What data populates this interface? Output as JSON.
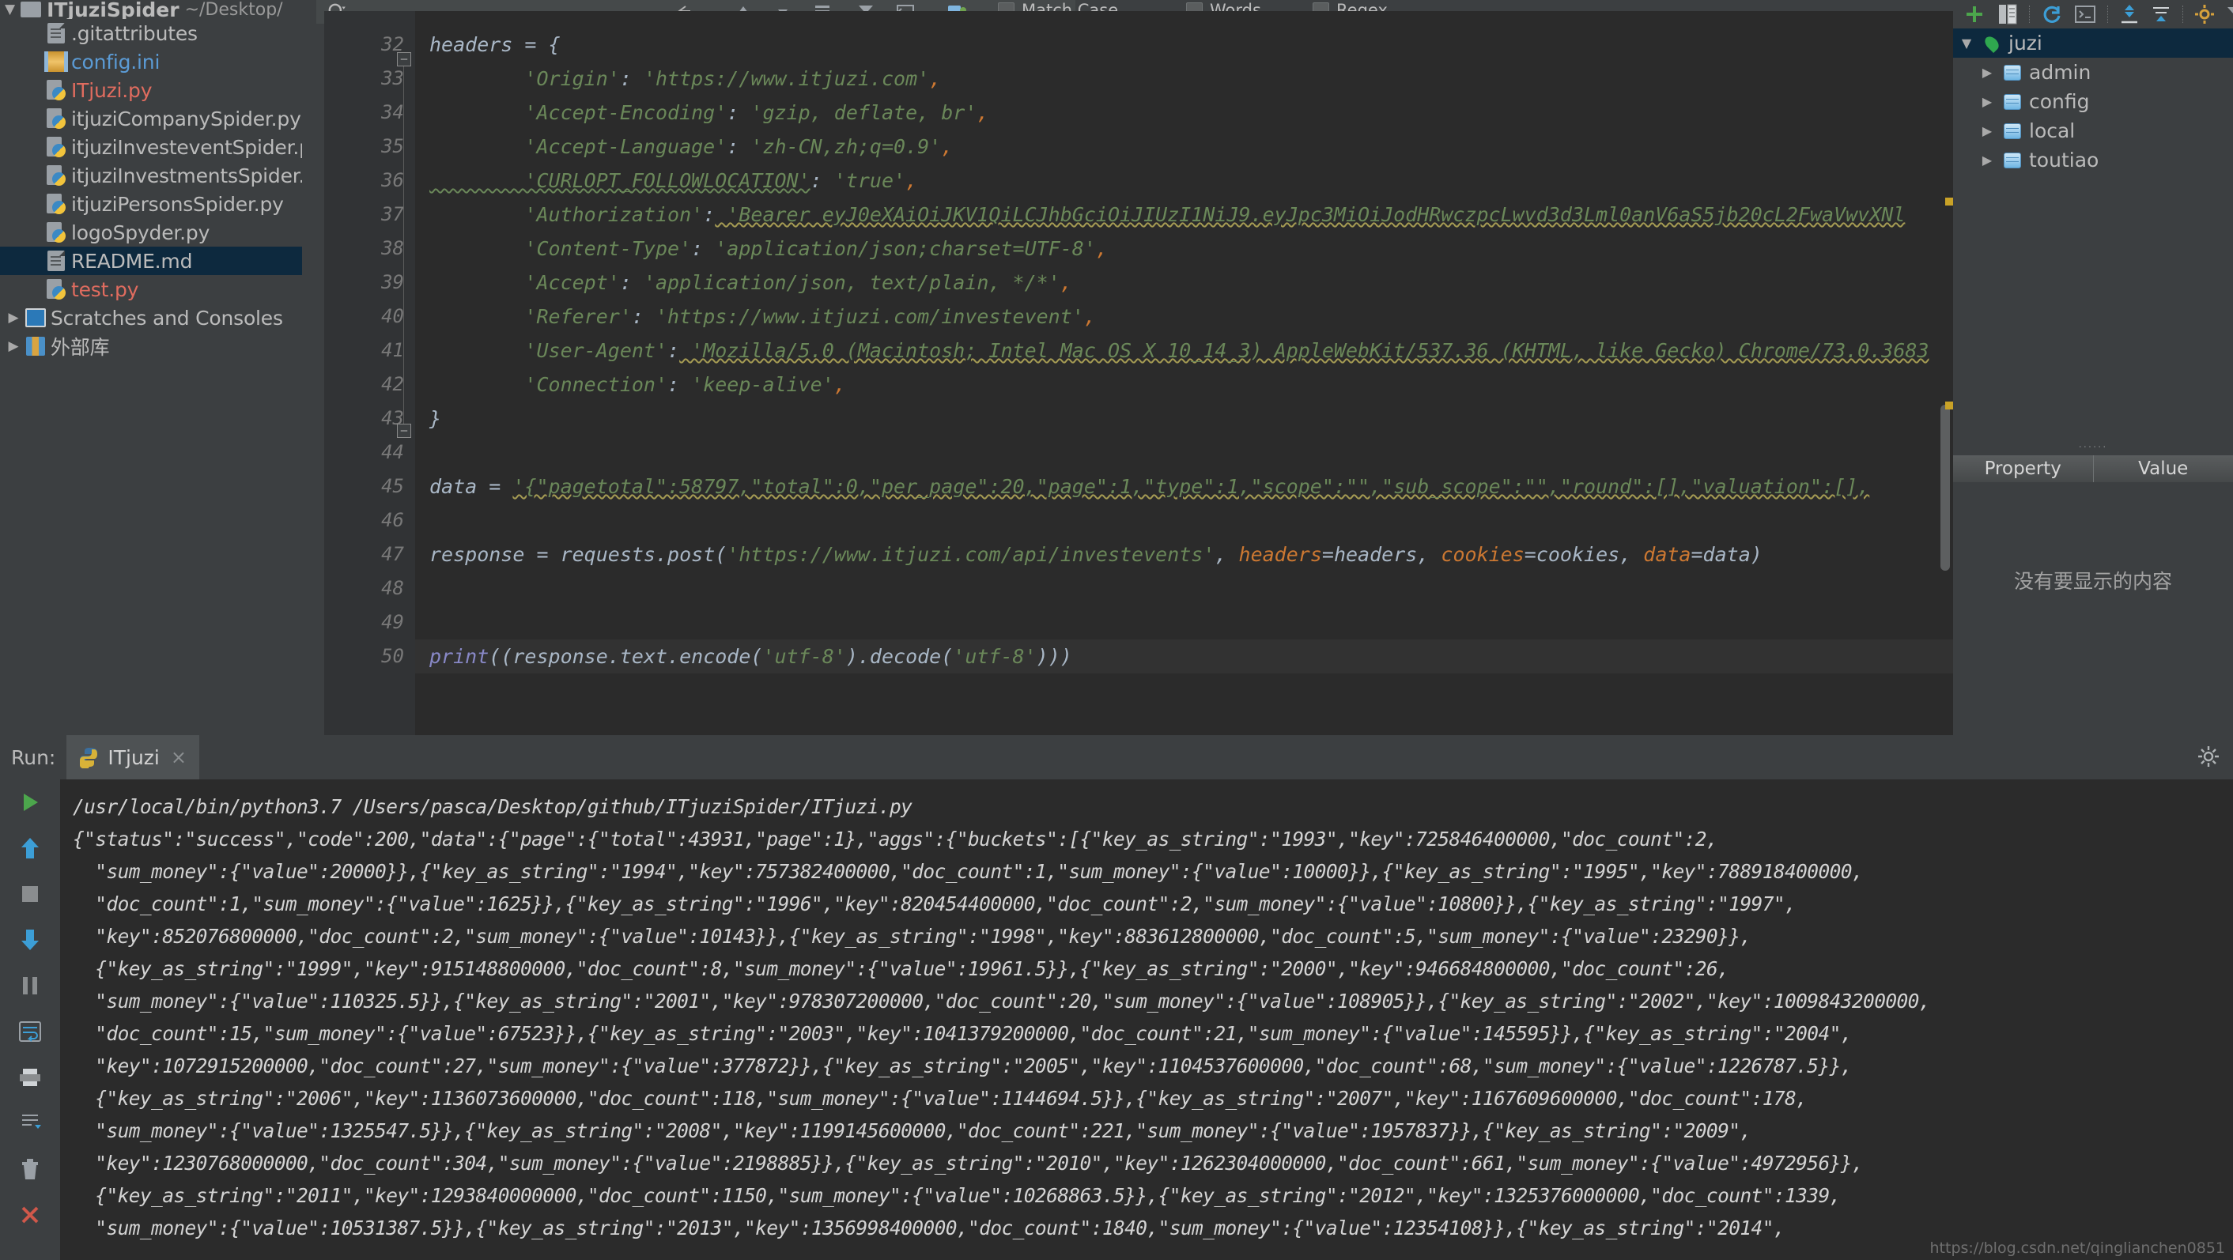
{
  "project": {
    "name": "ITjuziSpider",
    "path": "~/Desktop/",
    "tree": [
      {
        "label": ".gitattributes",
        "icon": "doc-icon",
        "color": "default",
        "indent": 1,
        "arrow": "",
        "selected": false
      },
      {
        "label": "config.ini",
        "icon": "ini-icon",
        "color": "blue",
        "indent": 1,
        "arrow": "",
        "selected": false
      },
      {
        "label": "ITjuzi.py",
        "icon": "python-file-icon",
        "color": "red",
        "indent": 1,
        "arrow": "",
        "selected": false
      },
      {
        "label": "itjuziCompanySpider.py",
        "icon": "python-file-icon",
        "color": "default",
        "indent": 1,
        "arrow": "",
        "selected": false
      },
      {
        "label": "itjuziInvesteventSpider.py",
        "icon": "python-file-icon",
        "color": "default",
        "indent": 1,
        "arrow": "",
        "selected": false
      },
      {
        "label": "itjuziInvestmentsSpider.py",
        "icon": "python-file-icon",
        "color": "default",
        "indent": 1,
        "arrow": "",
        "selected": false
      },
      {
        "label": "itjuziPersonsSpider.py",
        "icon": "python-file-icon",
        "color": "default",
        "indent": 1,
        "arrow": "",
        "selected": false
      },
      {
        "label": "logoSpyder.py",
        "icon": "python-file-icon",
        "color": "default",
        "indent": 1,
        "arrow": "",
        "selected": false
      },
      {
        "label": "README.md",
        "icon": "doc-icon",
        "color": "default",
        "indent": 1,
        "arrow": "",
        "selected": true
      },
      {
        "label": "test.py",
        "icon": "python-file-icon",
        "color": "red",
        "indent": 1,
        "arrow": "",
        "selected": false
      },
      {
        "label": "Scratches and Consoles",
        "icon": "console-icon",
        "color": "default",
        "indent": 0,
        "arrow": "▶",
        "selected": false
      },
      {
        "label": "外部库",
        "icon": "library-icon",
        "color": "default",
        "indent": 0,
        "arrow": "▶",
        "selected": false
      }
    ]
  },
  "search": {
    "value": "",
    "placeholder": "",
    "options": [
      {
        "label": "Match Case",
        "checked": false
      },
      {
        "label": "Words",
        "checked": false
      },
      {
        "label": "Regex",
        "checked": false
      }
    ]
  },
  "editor": {
    "first_line": 31,
    "lines": [
      {
        "num": 31,
        "text": "",
        "partial": true
      },
      {
        "num": 32,
        "fold": "open",
        "tokens": [
          {
            "t": "headers ",
            "c": "id"
          },
          {
            "t": "= {",
            "c": "def"
          }
        ]
      },
      {
        "num": 33,
        "tokens": [
          {
            "t": "        'Origin'",
            "c": "str"
          },
          {
            "t": ":",
            "c": "def"
          },
          {
            "t": " 'https://www.itjuzi.com'",
            "c": "str"
          },
          {
            "t": ",",
            "c": "kw"
          }
        ]
      },
      {
        "num": 34,
        "tokens": [
          {
            "t": "        'Accept-Encoding'",
            "c": "str"
          },
          {
            "t": ":",
            "c": "def"
          },
          {
            "t": " 'gzip, deflate, br'",
            "c": "str"
          },
          {
            "t": ",",
            "c": "kw"
          }
        ]
      },
      {
        "num": 35,
        "tokens": [
          {
            "t": "        'Accept-Language'",
            "c": "str"
          },
          {
            "t": ":",
            "c": "def"
          },
          {
            "t": " 'zh-CN,zh;q=0.9'",
            "c": "str"
          },
          {
            "t": ",",
            "c": "kw"
          }
        ]
      },
      {
        "num": 36,
        "tokens": [
          {
            "t": "        'CURLOPT_FOLLOWLOCATION'",
            "c": "str",
            "squiggle": true
          },
          {
            "t": ":",
            "c": "def"
          },
          {
            "t": " 'true'",
            "c": "str"
          },
          {
            "t": ",",
            "c": "kw"
          }
        ]
      },
      {
        "num": 37,
        "tokens": [
          {
            "t": "        'Authorization'",
            "c": "str"
          },
          {
            "t": ":",
            "c": "def"
          },
          {
            "t": " 'Bearer eyJ0eXAiOiJKV1QiLCJhbGciOiJIUzI1NiJ9.eyJpc3MiOiJodHRwczpcLwvd3d3Lml0anV6aS5jb20cL2FwaVwvXNl",
            "c": "str",
            "squiggle_y": true
          }
        ]
      },
      {
        "num": 38,
        "tokens": [
          {
            "t": "        'Content-Type'",
            "c": "str"
          },
          {
            "t": ":",
            "c": "def"
          },
          {
            "t": " 'application/json;charset=UTF-8'",
            "c": "str"
          },
          {
            "t": ",",
            "c": "kw"
          }
        ]
      },
      {
        "num": 39,
        "tokens": [
          {
            "t": "        'Accept'",
            "c": "str"
          },
          {
            "t": ":",
            "c": "def"
          },
          {
            "t": " 'application/json, text/plain, */*'",
            "c": "str"
          },
          {
            "t": ",",
            "c": "kw"
          }
        ]
      },
      {
        "num": 40,
        "tokens": [
          {
            "t": "        'Referer'",
            "c": "str"
          },
          {
            "t": ":",
            "c": "def"
          },
          {
            "t": " 'https://www.itjuzi.com/investevent'",
            "c": "str"
          },
          {
            "t": ",",
            "c": "kw"
          }
        ]
      },
      {
        "num": 41,
        "tokens": [
          {
            "t": "        'User-Agent'",
            "c": "str"
          },
          {
            "t": ":",
            "c": "def"
          },
          {
            "t": " 'Mozilla/5.0 (Macintosh; Intel Mac OS X 10_14_3) AppleWebKit/537.36 (KHTML, like Gecko) Chrome/73.0.3683",
            "c": "str",
            "squiggle_y": true
          }
        ]
      },
      {
        "num": 42,
        "tokens": [
          {
            "t": "        'Connection'",
            "c": "str"
          },
          {
            "t": ":",
            "c": "def"
          },
          {
            "t": " 'keep-alive'",
            "c": "str"
          },
          {
            "t": ",",
            "c": "kw"
          }
        ]
      },
      {
        "num": 43,
        "fold": "close",
        "tokens": [
          {
            "t": "}",
            "c": "def"
          }
        ]
      },
      {
        "num": 44,
        "tokens": []
      },
      {
        "num": 45,
        "tokens": [
          {
            "t": "data ",
            "c": "id"
          },
          {
            "t": "= ",
            "c": "def"
          },
          {
            "t": "'{\"pagetotal\":58797,\"total\":0,\"per_page\":20,\"page\":1,\"type\":1,\"scope\":\"\",\"sub_scope\":\"\",\"round\":[],\"valuation\":[],",
            "c": "str",
            "squiggle_y": true
          }
        ]
      },
      {
        "num": 46,
        "tokens": []
      },
      {
        "num": 47,
        "tokens": [
          {
            "t": "response ",
            "c": "id"
          },
          {
            "t": "= ",
            "c": "def"
          },
          {
            "t": "requests",
            "c": "id"
          },
          {
            "t": ".post(",
            "c": "def"
          },
          {
            "t": "'https://www.itjuzi.com/api/investevents'",
            "c": "str"
          },
          {
            "t": ", ",
            "c": "def"
          },
          {
            "t": "headers",
            "c": "param"
          },
          {
            "t": "=headers, ",
            "c": "def"
          },
          {
            "t": "cookies",
            "c": "param"
          },
          {
            "t": "=cookies, ",
            "c": "def"
          },
          {
            "t": "data",
            "c": "param"
          },
          {
            "t": "=data)",
            "c": "def"
          }
        ]
      },
      {
        "num": 48,
        "tokens": []
      },
      {
        "num": 49,
        "tokens": []
      },
      {
        "num": 50,
        "highlight": true,
        "tokens": [
          {
            "t": "print",
            "c": "builtin"
          },
          {
            "t": "((response.text.encode(",
            "c": "def"
          },
          {
            "t": "'utf-8'",
            "c": "str"
          },
          {
            "t": ").decode(",
            "c": "def"
          },
          {
            "t": "'utf-8'",
            "c": "str"
          },
          {
            "t": ")))",
            "c": "def"
          }
        ]
      },
      {
        "num": 51,
        "text": "",
        "partial": true
      }
    ]
  },
  "database_pane": {
    "toolbar_icons": [
      "add-icon",
      "copy-icon",
      "refresh-icon",
      "console-icon",
      "expand-icon",
      "collapse-icon",
      "settings-icon",
      "filter-icon",
      "hide-icon"
    ],
    "tree": [
      {
        "label": "juzi",
        "icon": "leaf-icon",
        "arrow": "▼",
        "indent": 0,
        "selected": true
      },
      {
        "label": "admin",
        "icon": "database-icon",
        "arrow": "▶",
        "indent": 1,
        "selected": false
      },
      {
        "label": "config",
        "icon": "database-icon",
        "arrow": "▶",
        "indent": 1,
        "selected": false
      },
      {
        "label": "local",
        "icon": "database-icon",
        "arrow": "▶",
        "indent": 1,
        "selected": false
      },
      {
        "label": "toutiao",
        "icon": "database-icon",
        "arrow": "▶",
        "indent": 1,
        "selected": false
      }
    ],
    "property_table": {
      "columns": [
        "Property",
        "Value"
      ],
      "empty_message": "没有要显示的内容"
    }
  },
  "run_panel": {
    "label": "Run:",
    "tab": {
      "label": "ITjuzi",
      "icon": "python-icon",
      "close": "×"
    },
    "sidebar_icons": [
      "rerun-icon",
      "up-icon",
      "stop-icon",
      "down-icon",
      "pause-icon",
      "soft-wrap-icon",
      "print-icon",
      "scroll-end-icon",
      "trash-icon",
      "close-icon"
    ],
    "console_lines": [
      "/usr/local/bin/python3.7 /Users/pasca/Desktop/github/ITjuziSpider/ITjuzi.py",
      "{\"status\":\"success\",\"code\":200,\"data\":{\"page\":{\"total\":43931,\"page\":1},\"aggs\":{\"buckets\":[{\"key_as_string\":\"1993\",\"key\":725846400000,\"doc_count\":2,",
      "  \"sum_money\":{\"value\":20000}},{\"key_as_string\":\"1994\",\"key\":757382400000,\"doc_count\":1,\"sum_money\":{\"value\":10000}},{\"key_as_string\":\"1995\",\"key\":788918400000,",
      "  \"doc_count\":1,\"sum_money\":{\"value\":1625}},{\"key_as_string\":\"1996\",\"key\":820454400000,\"doc_count\":2,\"sum_money\":{\"value\":10800}},{\"key_as_string\":\"1997\",",
      "  \"key\":852076800000,\"doc_count\":2,\"sum_money\":{\"value\":10143}},{\"key_as_string\":\"1998\",\"key\":883612800000,\"doc_count\":5,\"sum_money\":{\"value\":23290}},",
      "  {\"key_as_string\":\"1999\",\"key\":915148800000,\"doc_count\":8,\"sum_money\":{\"value\":19961.5}},{\"key_as_string\":\"2000\",\"key\":946684800000,\"doc_count\":26,",
      "  \"sum_money\":{\"value\":110325.5}},{\"key_as_string\":\"2001\",\"key\":978307200000,\"doc_count\":20,\"sum_money\":{\"value\":108905}},{\"key_as_string\":\"2002\",\"key\":1009843200000,",
      "  \"doc_count\":15,\"sum_money\":{\"value\":67523}},{\"key_as_string\":\"2003\",\"key\":1041379200000,\"doc_count\":21,\"sum_money\":{\"value\":145595}},{\"key_as_string\":\"2004\",",
      "  \"key\":1072915200000,\"doc_count\":27,\"sum_money\":{\"value\":377872}},{\"key_as_string\":\"2005\",\"key\":1104537600000,\"doc_count\":68,\"sum_money\":{\"value\":1226787.5}},",
      "  {\"key_as_string\":\"2006\",\"key\":1136073600000,\"doc_count\":118,\"sum_money\":{\"value\":1144694.5}},{\"key_as_string\":\"2007\",\"key\":1167609600000,\"doc_count\":178,",
      "  \"sum_money\":{\"value\":1325547.5}},{\"key_as_string\":\"2008\",\"key\":1199145600000,\"doc_count\":221,\"sum_money\":{\"value\":1957837}},{\"key_as_string\":\"2009\",",
      "  \"key\":1230768000000,\"doc_count\":304,\"sum_money\":{\"value\":2198885}},{\"key_as_string\":\"2010\",\"key\":1262304000000,\"doc_count\":661,\"sum_money\":{\"value\":4972956}},",
      "  {\"key_as_string\":\"2011\",\"key\":1293840000000,\"doc_count\":1150,\"sum_money\":{\"value\":10268863.5}},{\"key_as_string\":\"2012\",\"key\":1325376000000,\"doc_count\":1339,",
      "  \"sum_money\":{\"value\":10531387.5}},{\"key_as_string\":\"2013\",\"key\":1356998400000,\"doc_count\":1840,\"sum_money\":{\"value\":12354108}},{\"key_as_string\":\"2014\","
    ],
    "watermark": "https://blog.csdn.net/qinglianchen0851"
  }
}
